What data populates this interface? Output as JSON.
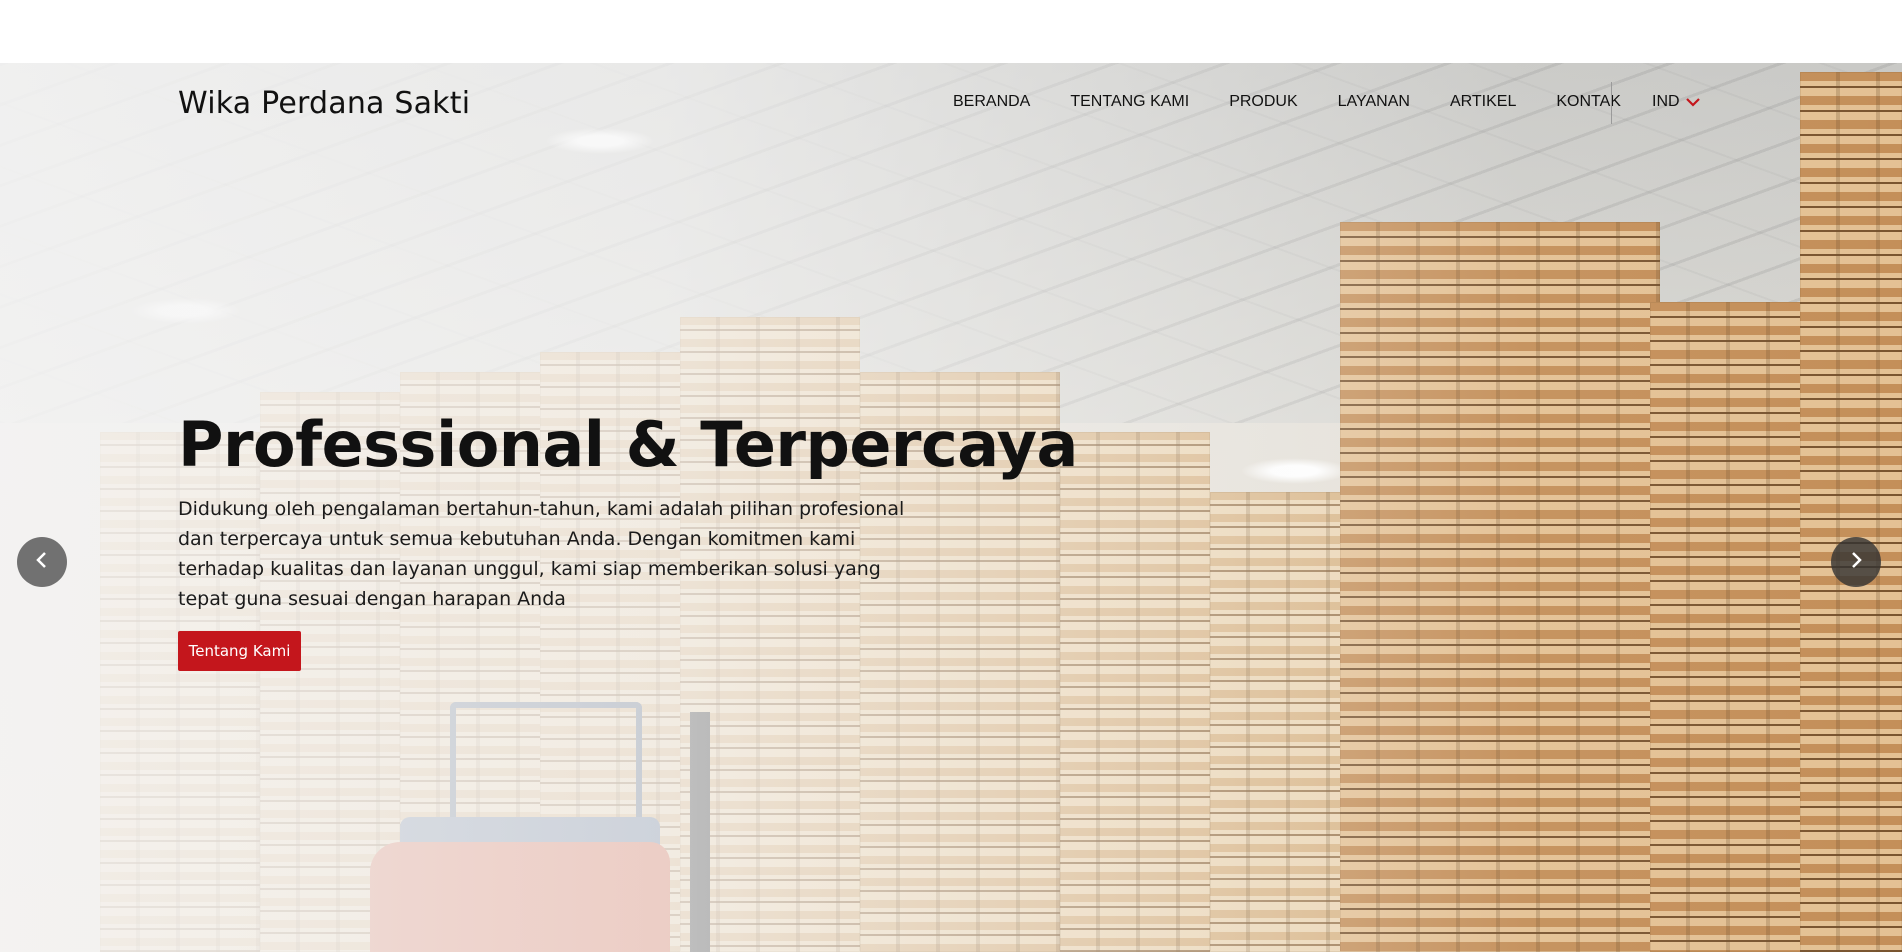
{
  "header": {
    "brand": "Wika Perdana Sakti",
    "nav": [
      "BERANDA",
      "TENTANG KAMI",
      "PRODUK",
      "LAYANAN",
      "ARTIKEL",
      "KONTAK"
    ],
    "language": "IND"
  },
  "hero": {
    "title": "Professional & Terpercaya",
    "description": "Didukung oleh pengalaman bertahun-tahun, kami adalah pilihan profesional dan terpercaya untuk semua kebutuhan Anda. Dengan komitmen kami terhadap kualitas dan layanan unggul, kami siap memberikan solusi yang tepat guna sesuai dengan harapan Anda",
    "cta": "Tentang Kami",
    "background": "warehouse-pallets-image"
  },
  "icons": {
    "prev": "chevron-left-icon",
    "next": "chevron-right-icon",
    "language_dropdown": "chevron-down-icon"
  },
  "colors": {
    "accent": "#c4161c",
    "text": "#111111",
    "arrow_bg": "#464646"
  }
}
